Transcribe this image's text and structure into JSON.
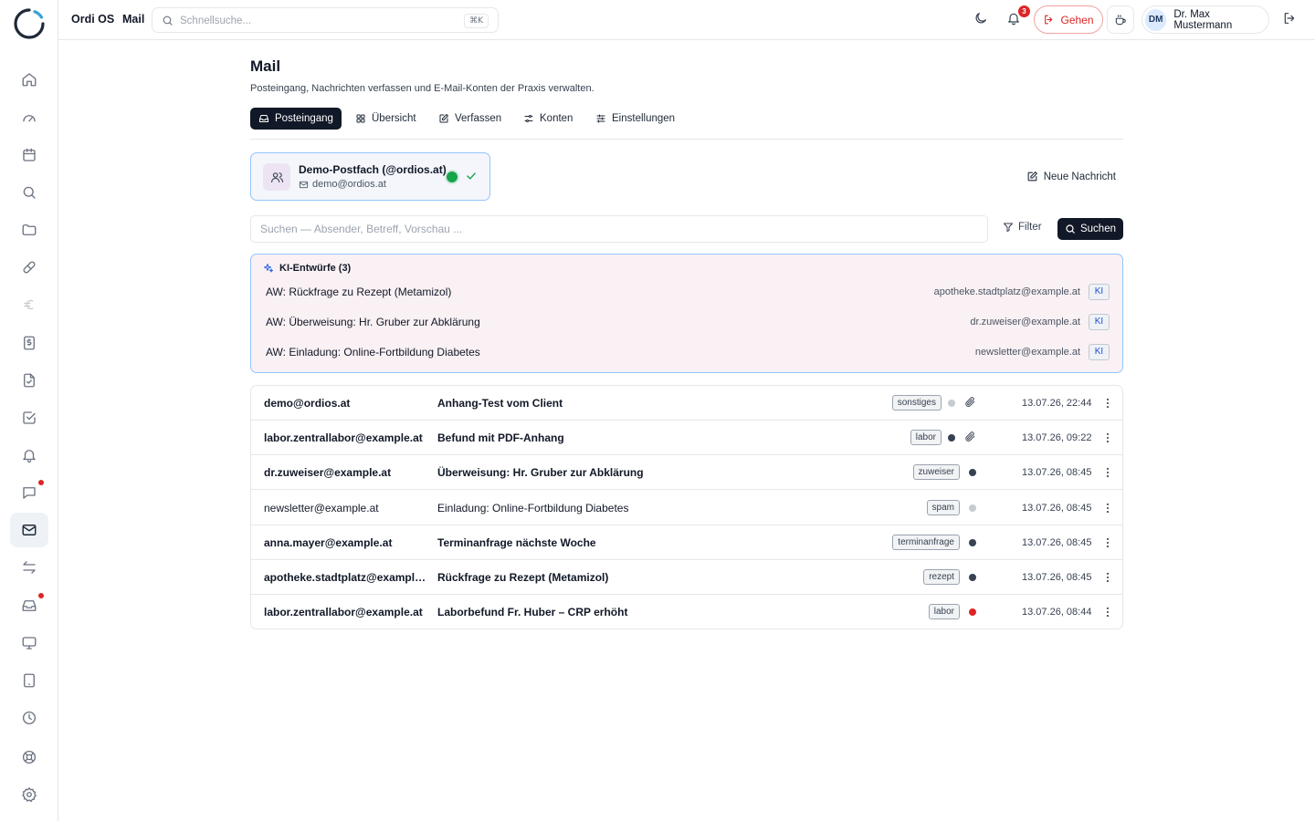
{
  "breadcrumb": [
    "Ordi OS",
    "Mail"
  ],
  "quicksearch": {
    "placeholder": "Schnellsuche...",
    "shortcut": "⌘K"
  },
  "notifications": {
    "count": "3"
  },
  "go_button": "Gehen",
  "user": {
    "initials": "DM",
    "name": "Dr. Max Mustermann"
  },
  "sidebar": {
    "items": [
      {
        "name": "home-icon"
      },
      {
        "name": "dashboard-icon"
      },
      {
        "name": "calendar-icon"
      },
      {
        "name": "search-icon"
      },
      {
        "name": "folder-icon"
      },
      {
        "name": "pill-icon"
      },
      {
        "name": "euro-icon"
      },
      {
        "name": "dollar-document-icon"
      },
      {
        "name": "checked-document-icon"
      },
      {
        "name": "checkbox-icon"
      },
      {
        "name": "bell-icon"
      },
      {
        "name": "chat-icon"
      },
      {
        "name": "mail-icon"
      },
      {
        "name": "transfer-icon"
      },
      {
        "name": "inbox-icon"
      },
      {
        "name": "monitor-icon"
      },
      {
        "name": "tablet-icon"
      },
      {
        "name": "clock-icon"
      },
      {
        "name": "help-icon"
      },
      {
        "name": "settings-icon"
      }
    ]
  },
  "page": {
    "title": "Mail",
    "subtitle": "Posteingang, Nachrichten verfassen und E-Mail-Konten der Praxis verwalten."
  },
  "tabs": [
    {
      "label": "Posteingang",
      "active": true
    },
    {
      "label": "Übersicht"
    },
    {
      "label": "Verfassen"
    },
    {
      "label": "Konten"
    },
    {
      "label": "Einstellungen"
    }
  ],
  "account": {
    "name": "Demo-Postfach (@ordios.at)",
    "email": "demo@ordios.at"
  },
  "new_message_label": "Neue Nachricht",
  "search": {
    "placeholder": "Suchen — Absender, Betreff, Vorschau ...",
    "filter_label": "Filter",
    "button_label": "Suchen"
  },
  "ki_drafts": {
    "title": "KI-Entwürfe (3)",
    "tag": "KI",
    "items": [
      {
        "subject": "AW: Rückfrage zu Rezept (Metamizol)",
        "sender": "apotheke.stadtplatz@example.at"
      },
      {
        "subject": "AW: Überweisung: Hr. Gruber zur Abklärung",
        "sender": "dr.zuweiser@example.at"
      },
      {
        "subject": "AW: Einladung: Online-Fortbildung Diabetes",
        "sender": "newsletter@example.at"
      }
    ]
  },
  "colors": {
    "dot_grey": "#c7cbd1",
    "dot_dark": "#374151",
    "dot_red": "#dc2626",
    "accent_green": "#16a34a",
    "ki_border": "#93c5fd"
  },
  "mails": [
    {
      "sender": "demo@ordios.at",
      "subject": "Anhang-Test vom Client",
      "category": "sonstiges",
      "dot": "#c7cbd1",
      "attachment": true,
      "time": "13.07.26, 22:44",
      "unread": true
    },
    {
      "sender": "labor.zentrallabor@example.at",
      "subject": "Befund mit PDF-Anhang",
      "category": "labor",
      "dot": "#374151",
      "attachment": true,
      "time": "13.07.26, 09:22",
      "unread": true
    },
    {
      "sender": "dr.zuweiser@example.at",
      "subject": "Überweisung: Hr. Gruber zur Abklärung",
      "category": "zuweiser",
      "dot": "#374151",
      "attachment": false,
      "time": "13.07.26, 08:45",
      "unread": true
    },
    {
      "sender": "newsletter@example.at",
      "subject": "Einladung: Online-Fortbildung Diabetes",
      "category": "spam",
      "dot": "#c7cbd1",
      "attachment": false,
      "time": "13.07.26, 08:45",
      "unread": false
    },
    {
      "sender": "anna.mayer@example.at",
      "subject": "Terminanfrage nächste Woche",
      "category": "terminanfrage",
      "dot": "#374151",
      "attachment": false,
      "time": "13.07.26, 08:45",
      "unread": true
    },
    {
      "sender": "apotheke.stadtplatz@example.at",
      "subject": "Rückfrage zu Rezept (Metamizol)",
      "category": "rezept",
      "dot": "#374151",
      "attachment": false,
      "time": "13.07.26, 08:45",
      "unread": true
    },
    {
      "sender": "labor.zentrallabor@example.at",
      "subject": "Laborbefund Fr. Huber – CRP erhöht",
      "category": "labor",
      "dot": "#dc2626",
      "attachment": false,
      "time": "13.07.26, 08:44",
      "unread": true
    }
  ]
}
